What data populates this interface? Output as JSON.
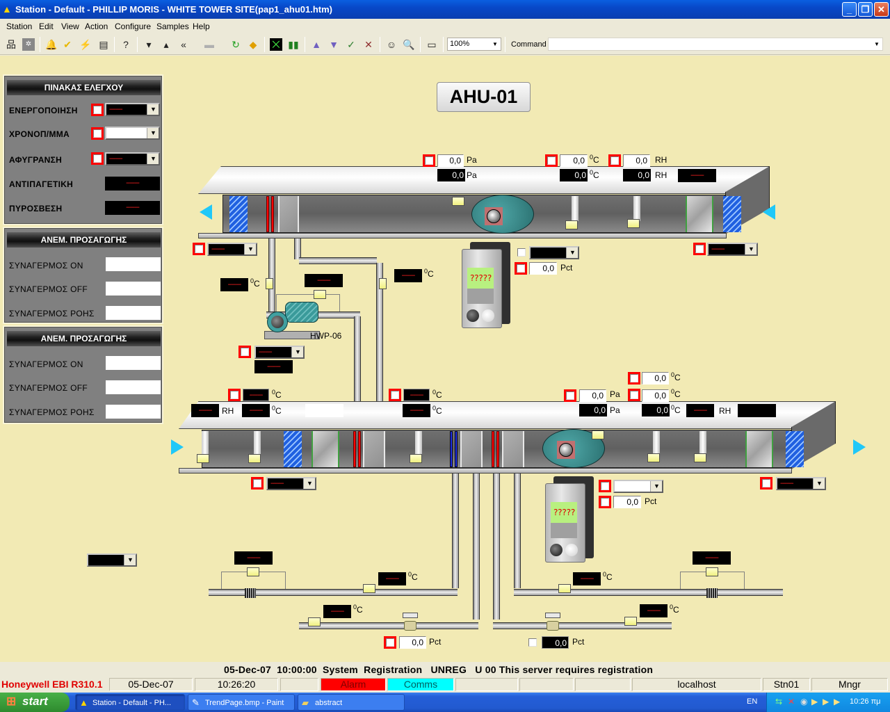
{
  "window": {
    "title": "Station - Default - PHILLIP MORIS - WHITE TOWER SITE(pap1_ahu01.htm)",
    "controls": {
      "minimize": "_",
      "restore": "❐",
      "close": "✕"
    }
  },
  "menubar": [
    "Station",
    "Edit",
    "View",
    "Action",
    "Configure",
    "Samples",
    "Help"
  ],
  "toolbar": {
    "icons": [
      "hierarchy-icon",
      "system-icon",
      "alarm-bell-icon",
      "acknowledge-bell-icon",
      "event-icon",
      "report-icon",
      "help-icon",
      "page-down-icon",
      "page-up-icon",
      "back-icon",
      "disabled-page-icon",
      "refresh-page-icon",
      "print-icon",
      "trend-icon",
      "group-icon",
      "raise-icon",
      "lower-icon",
      "accept-icon",
      "cancel-icon",
      "connect-icon",
      "find-icon",
      "camera-icon"
    ],
    "zoom_value": "100%",
    "command_label": "Command",
    "command_value": ""
  },
  "main": {
    "title": "AHU-01",
    "dash": "--------",
    "zero": "0,0",
    "units": {
      "pa": "Pa",
      "c": "C",
      "deg": "0",
      "rh": "RH",
      "pct": "Pct"
    },
    "pump_label": "HWP-06",
    "vfd_display": "?????"
  },
  "panels": [
    {
      "title": "ΠΙΝΑΚΑΣ ΕΛΕΓΧΟΥ",
      "rows": [
        {
          "label": "ΕΝΕΡΓΟΠΟΙΗΣΗ",
          "type": "select",
          "value": "--------"
        },
        {
          "label": "ΧΡΟΝΟΠ/ΜΜΑ",
          "type": "select",
          "value": ""
        },
        {
          "label": "ΑΦΥΓΡΑΝΣΗ",
          "type": "select",
          "value": "--------"
        },
        {
          "label": "ΑΝΤΙΠΑΓΕΤΙΚΗ",
          "type": "display",
          "value": "--------"
        },
        {
          "label": "ΠΥΡΟΣΒΕΣΗ",
          "type": "display",
          "value": "--------"
        }
      ]
    },
    {
      "title": "ΑΝΕΜ. ΠΡΟΣΑΓΩΓΗΣ",
      "rows": [
        {
          "label": "ΣΥΝΑΓΕΡΜΟΣ ON",
          "value": ""
        },
        {
          "label": "ΣΥΝΑΓΕΡΜΟΣ OFF",
          "value": ""
        },
        {
          "label": "ΣΥΝΑΓΕΡΜΟΣ ΡΟΗΣ",
          "value": ""
        }
      ]
    },
    {
      "title": "ΑΝΕΜ. ΠΡΟΣΑΓΩΓΗΣ",
      "rows": [
        {
          "label": "ΣΥΝΑΓΕΡΜΟΣ ON",
          "value": ""
        },
        {
          "label": "ΣΥΝΑΓΕΡΜΟΣ OFF",
          "value": ""
        },
        {
          "label": "ΣΥΝΑΓΕΡΜΟΣ ΡΟΗΣ",
          "value": ""
        }
      ]
    }
  ],
  "message_bar": "05-Dec-07  10:00:00  System  Registration   UNREG   U 00 This server requires registration",
  "statusbar": {
    "brand": "Honeywell EBI R310.1",
    "date": "05-Dec-07",
    "time": "10:26:20",
    "alarm": "Alarm",
    "comms": "Comms",
    "host": "localhost",
    "station": "Stn01",
    "user": "Mngr",
    "alarm_color": "#ff0000",
    "comms_color": "#00ffff"
  },
  "taskbar": {
    "start": "start",
    "items": [
      {
        "label": "Station - Default - PH...",
        "active": true
      },
      {
        "label": "TrendPage.bmp - Paint",
        "active": false
      },
      {
        "label": "abstract",
        "active": false
      }
    ],
    "lang": "EN",
    "clock": "10:26 πμ"
  }
}
